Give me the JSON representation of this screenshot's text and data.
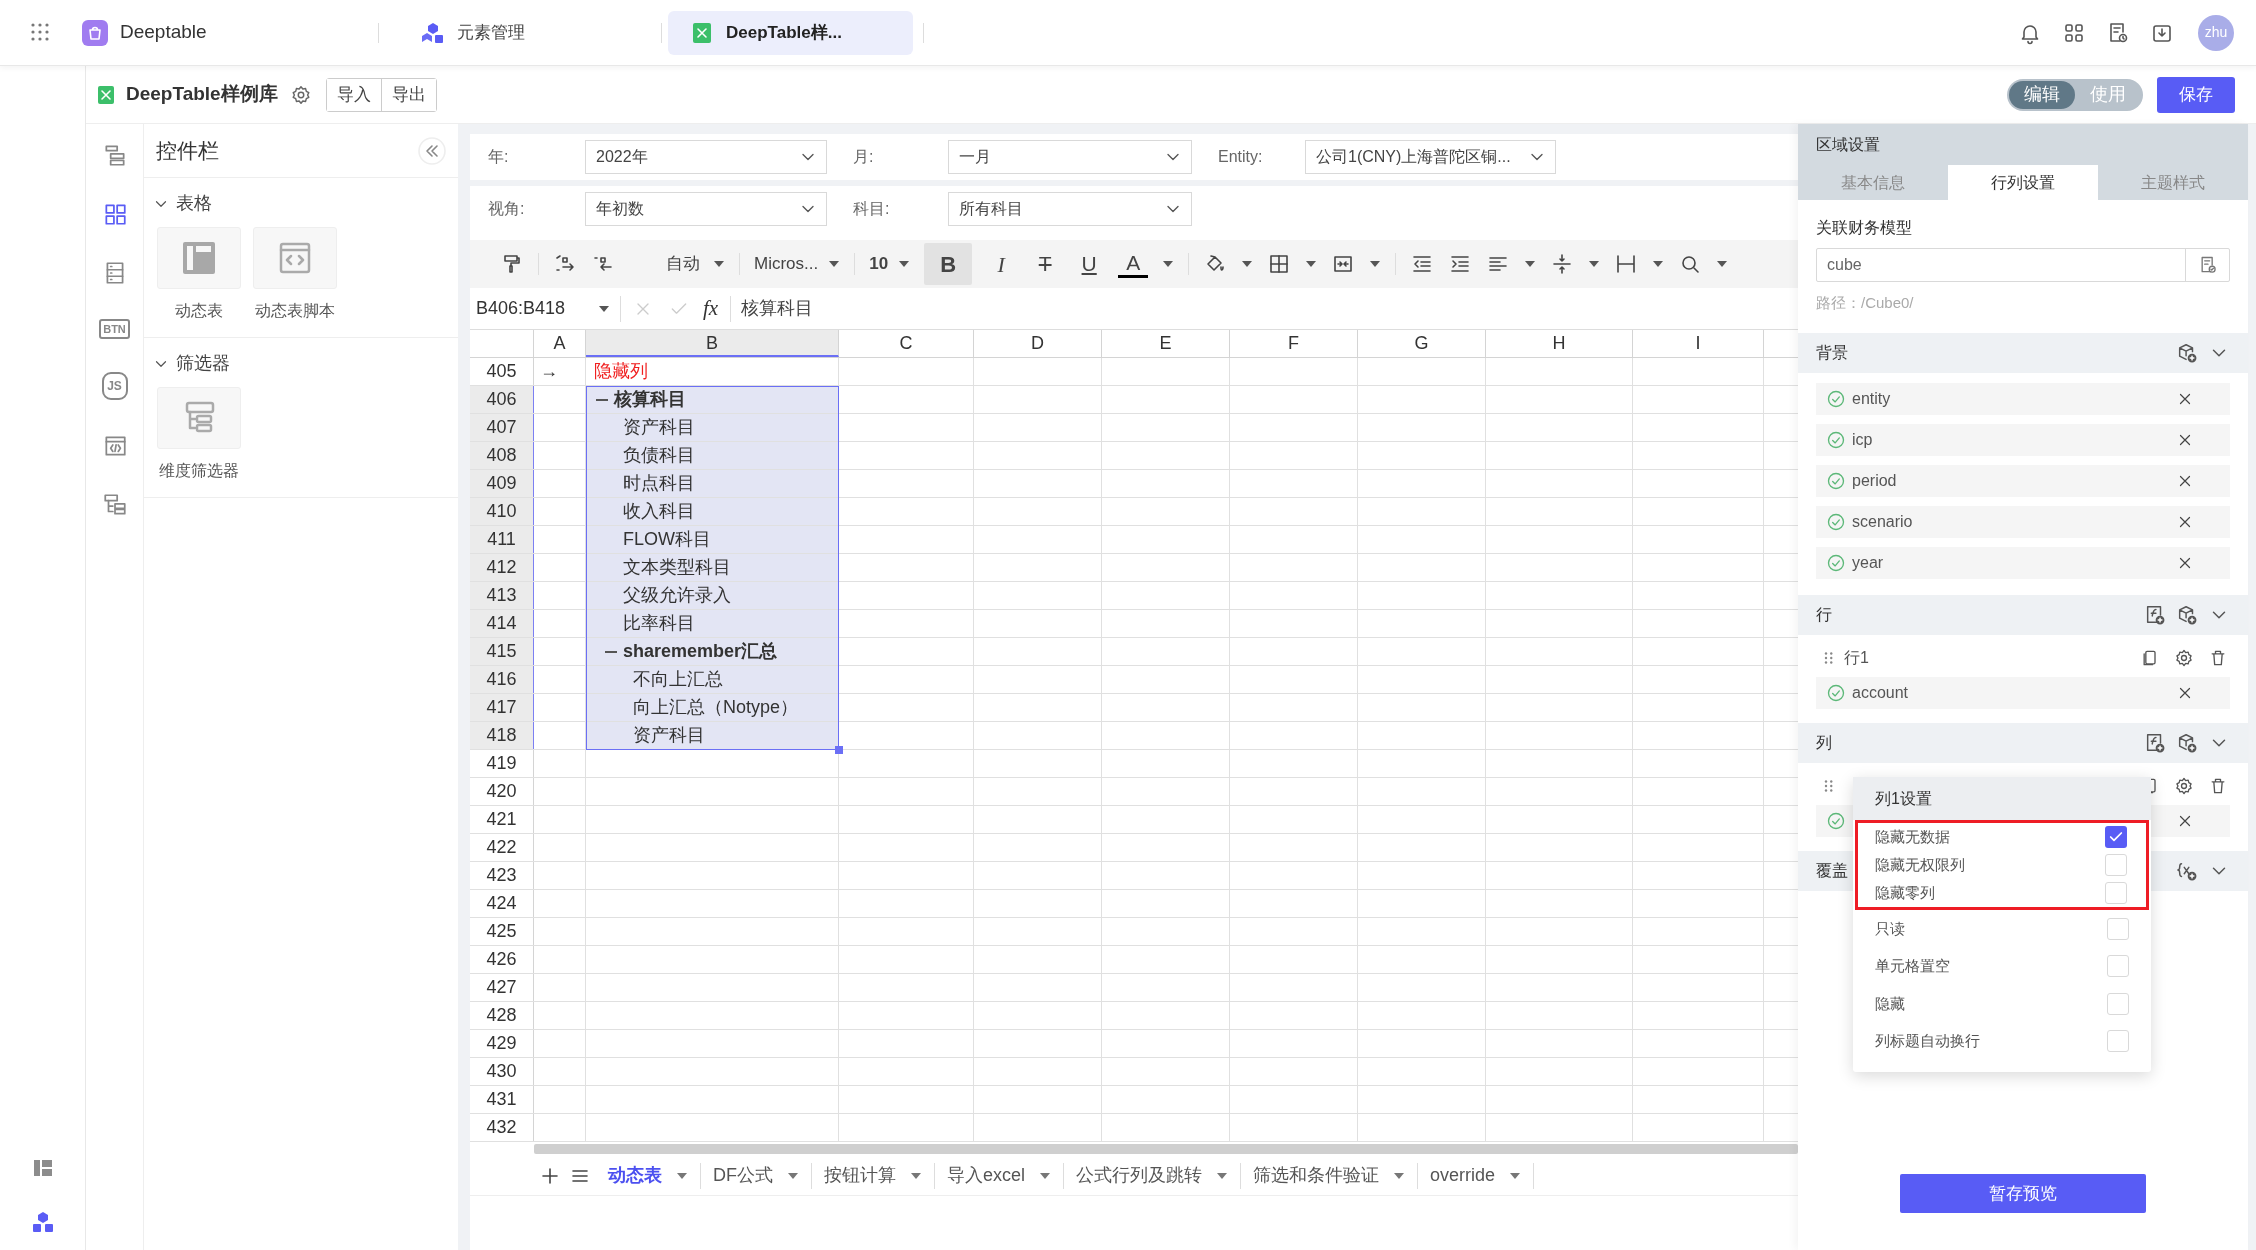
{
  "app_bar": {
    "tabs": [
      {
        "label": "Deeptable",
        "selected": false
      },
      {
        "label": "元素管理",
        "selected": false
      },
      {
        "label": "DeepTable样...",
        "selected": true
      }
    ],
    "avatar": "zhu"
  },
  "doc_bar": {
    "title": "DeepTable样例库",
    "actions": [
      "导入",
      "导出"
    ],
    "mode_toggle": [
      {
        "label": "编辑",
        "selected": true
      },
      {
        "label": "使用",
        "selected": false
      }
    ],
    "save": "保存"
  },
  "rail": [
    {
      "kind": "icon",
      "selected": false
    },
    {
      "kind": "icon",
      "selected": true
    },
    {
      "kind": "icon",
      "selected": false
    },
    {
      "kind": "badge",
      "label": "BTN",
      "selected": false
    },
    {
      "kind": "hexagon",
      "label": "JS",
      "selected": false
    },
    {
      "kind": "icon",
      "selected": false
    },
    {
      "kind": "icon",
      "selected": false
    }
  ],
  "widgets": {
    "title": "控件栏",
    "sections": [
      {
        "title": "表格",
        "expanded": true,
        "items": [
          "动态表",
          "动态表脚本"
        ]
      },
      {
        "title": "筛选器",
        "expanded": true,
        "items": [
          "维度筛选器"
        ]
      }
    ]
  },
  "filters": [
    [
      {
        "label": "年:",
        "value": "2022年"
      },
      {
        "label": "月:",
        "value": "一月"
      },
      {
        "label": "Entity:",
        "value": "公司1(CNY)上海普陀区铜..."
      }
    ],
    [
      {
        "label": "视角:",
        "value": "年初数"
      },
      {
        "label": "科目:",
        "value": "所有科目"
      }
    ]
  ],
  "toolbar": {
    "number_format": "自动",
    "font": "Micros...",
    "font_size": "10",
    "bold": {
      "label": "B",
      "active": true
    },
    "italic": "I",
    "strikethrough": "T",
    "underline": "U",
    "font_color": "A"
  },
  "formula_bar": {
    "name_box": "B406:B418",
    "fx": "fx",
    "formula": "核算科目"
  },
  "sheet": {
    "columns": [
      {
        "label": "A",
        "selected": false
      },
      {
        "label": "B",
        "selected": true
      },
      {
        "label": "C",
        "selected": false
      },
      {
        "label": "D",
        "selected": false
      },
      {
        "label": "E",
        "selected": false
      },
      {
        "label": "F",
        "selected": false
      },
      {
        "label": "G",
        "selected": false
      },
      {
        "label": "H",
        "selected": false
      },
      {
        "label": "I",
        "selected": false
      }
    ],
    "rows": [
      {
        "label": "405",
        "selected": false
      },
      {
        "label": "406",
        "selected": true
      },
      {
        "label": "407",
        "selected": true
      },
      {
        "label": "408",
        "selected": true
      },
      {
        "label": "409",
        "selected": true
      },
      {
        "label": "410",
        "selected": true
      },
      {
        "label": "411",
        "selected": true
      },
      {
        "label": "412",
        "selected": true
      },
      {
        "label": "413",
        "selected": true
      },
      {
        "label": "414",
        "selected": true
      },
      {
        "label": "415",
        "selected": true
      },
      {
        "label": "416",
        "selected": true
      },
      {
        "label": "417",
        "selected": true
      },
      {
        "label": "418",
        "selected": true
      },
      {
        "label": "419",
        "selected": false
      },
      {
        "label": "420",
        "selected": false
      },
      {
        "label": "421",
        "selected": false
      },
      {
        "label": "422",
        "selected": false
      },
      {
        "label": "423",
        "selected": false
      },
      {
        "label": "424",
        "selected": false
      },
      {
        "label": "425",
        "selected": false
      },
      {
        "label": "426",
        "selected": false
      },
      {
        "label": "427",
        "selected": false
      },
      {
        "label": "428",
        "selected": false
      },
      {
        "label": "429",
        "selected": false
      },
      {
        "label": "430",
        "selected": false
      },
      {
        "label": "431",
        "selected": false
      },
      {
        "label": "432",
        "selected": false
      }
    ],
    "first_row": {
      "marker": "→",
      "note": "隐藏列"
    },
    "tree": [
      {
        "label": "核算科目",
        "expanded": true,
        "children": [
          {
            "label": "资产科目"
          },
          {
            "label": "负债科目"
          },
          {
            "label": "时点科目"
          },
          {
            "label": "收入科目"
          },
          {
            "label": "FLOW科目"
          },
          {
            "label": "文本类型科目"
          },
          {
            "label": "父级允许录入"
          },
          {
            "label": "比率科目"
          },
          {
            "label": "sharemember汇总",
            "expanded": true,
            "children": [
              {
                "label": "不向上汇总"
              },
              {
                "label": "向上汇总（Notype）"
              },
              {
                "label": "资产科目"
              }
            ]
          }
        ]
      }
    ],
    "tabs": [
      {
        "label": "动态表",
        "selected": true
      },
      {
        "label": "DF公式",
        "selected": false
      },
      {
        "label": "按钮计算",
        "selected": false
      },
      {
        "label": "导入excel",
        "selected": false
      },
      {
        "label": "公式行列及跳转",
        "selected": false
      },
      {
        "label": "筛选和条件验证",
        "selected": false
      },
      {
        "label": "override",
        "selected": false
      }
    ]
  },
  "panel": {
    "title": "区域设置",
    "tabs": [
      {
        "label": "基本信息",
        "selected": false
      },
      {
        "label": "行列设置",
        "selected": true
      },
      {
        "label": "主题样式",
        "selected": false
      }
    ],
    "model_label": "关联财务模型",
    "model_value": "cube",
    "path": "路径：/Cube0/",
    "sections": [
      {
        "title": "背景",
        "kind": "dims",
        "dims": [
          {
            "name": "entity",
            "valid": true
          },
          {
            "name": "icp",
            "valid": true
          },
          {
            "name": "period",
            "valid": true
          },
          {
            "name": "scenario",
            "valid": true
          },
          {
            "name": "year",
            "valid": true
          }
        ]
      },
      {
        "title": "行",
        "kind": "groups",
        "groups": [
          {
            "label": "行1",
            "dims": [
              {
                "name": "account",
                "valid": true
              }
            ]
          }
        ]
      },
      {
        "title": "列",
        "kind": "groups",
        "groups": [
          {
            "dims": [
              {
                "valid": true
              }
            ]
          }
        ]
      },
      {
        "title": "覆盖",
        "kind": "variables"
      }
    ],
    "popover": {
      "title": "列1设置",
      "options": [
        {
          "label": "隐藏无数据",
          "checked": true,
          "highlighted": true
        },
        {
          "label": "隐藏无权限列",
          "checked": false,
          "highlighted": true
        },
        {
          "label": "隐藏零列",
          "checked": false,
          "highlighted": true
        },
        {
          "label": "只读",
          "checked": false,
          "highlighted": false
        },
        {
          "label": "单元格置空",
          "checked": false,
          "highlighted": false
        },
        {
          "label": "隐藏",
          "checked": false,
          "highlighted": false
        },
        {
          "label": "列标题自动换行",
          "checked": false,
          "highlighted": false
        }
      ]
    },
    "apply": "暂存预览"
  }
}
